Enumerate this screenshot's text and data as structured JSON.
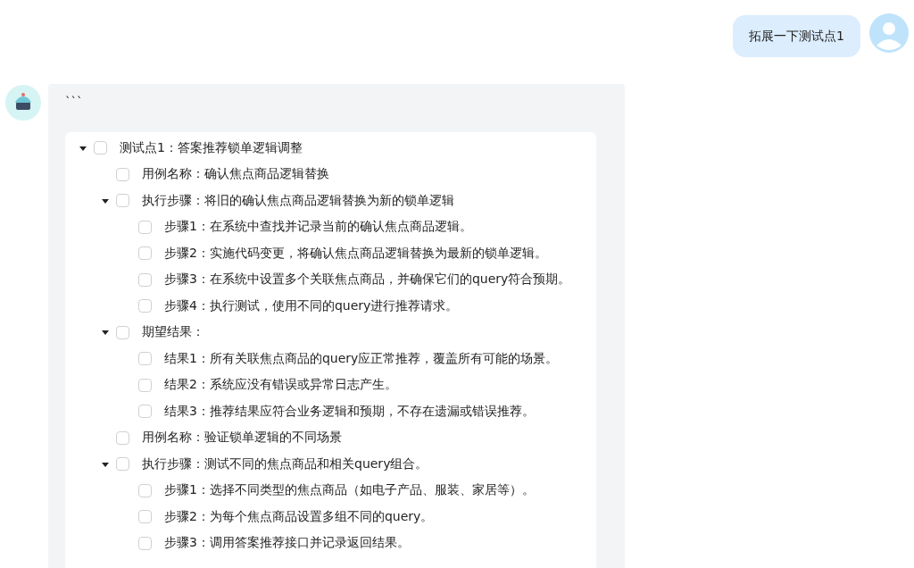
{
  "user_message": {
    "text": "拓展一下测试点1"
  },
  "reply": {
    "code_fence": "```",
    "tree": [
      {
        "text": "测试点1：答案推荐锁单逻辑调整",
        "checked": false,
        "expanded": true,
        "children": [
          {
            "text": "用例名称：确认焦点商品逻辑替换",
            "checked": false
          },
          {
            "text": "执行步骤：将旧的确认焦点商品逻辑替换为新的锁单逻辑",
            "checked": false,
            "expanded": true,
            "children": [
              {
                "text": "步骤1：在系统中查找并记录当前的确认焦点商品逻辑。",
                "checked": false
              },
              {
                "text": "步骤2：实施代码变更，将确认焦点商品逻辑替换为最新的锁单逻辑。",
                "checked": false
              },
              {
                "text": "步骤3：在系统中设置多个关联焦点商品，并确保它们的query符合预期。",
                "checked": false
              },
              {
                "text": "步骤4：执行测试，使用不同的query进行推荐请求。",
                "checked": false
              }
            ]
          },
          {
            "text": "期望结果：",
            "checked": false,
            "expanded": true,
            "children": [
              {
                "text": "结果1：所有关联焦点商品的query应正常推荐，覆盖所有可能的场景。",
                "checked": false
              },
              {
                "text": "结果2：系统应没有错误或异常日志产生。",
                "checked": false
              },
              {
                "text": "结果3：推荐结果应符合业务逻辑和预期，不存在遗漏或错误推荐。",
                "checked": false
              }
            ]
          },
          {
            "text": "用例名称：验证锁单逻辑的不同场景",
            "checked": false
          },
          {
            "text": "执行步骤：测试不同的焦点商品和相关query组合。",
            "checked": false,
            "expanded": true,
            "children": [
              {
                "text": "步骤1：选择不同类型的焦点商品（如电子产品、服装、家居等）。",
                "checked": false
              },
              {
                "text": "步骤2：为每个焦点商品设置多组不同的query。",
                "checked": false
              },
              {
                "text": "步骤3：调用答案推荐接口并记录返回结果。",
                "checked": false
              }
            ]
          }
        ]
      }
    ]
  }
}
